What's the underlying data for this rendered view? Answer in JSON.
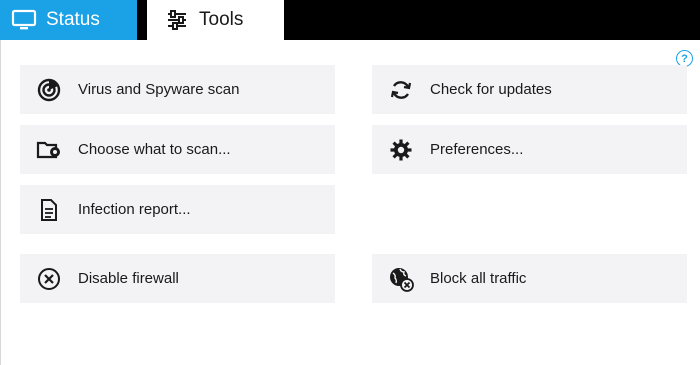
{
  "tabs": {
    "status": {
      "label": "Status",
      "icon": "monitor-icon",
      "color": "#1aa1e6"
    },
    "tools": {
      "label": "Tools",
      "icon": "sliders-icon"
    }
  },
  "help": {
    "label": "?"
  },
  "tools": {
    "left": [
      {
        "label": "Virus and Spyware scan",
        "icon": "scan-radar-icon"
      },
      {
        "label": "Choose what to scan...",
        "icon": "folder-scan-icon"
      },
      {
        "label": "Infection report...",
        "icon": "document-icon"
      },
      {
        "label": "Disable firewall",
        "icon": "circle-x-icon"
      }
    ],
    "right": [
      {
        "label": "Check for updates",
        "icon": "refresh-icon"
      },
      {
        "label": "Preferences...",
        "icon": "gear-icon"
      },
      {
        "label": "Block all traffic",
        "icon": "globe-block-icon"
      }
    ]
  }
}
